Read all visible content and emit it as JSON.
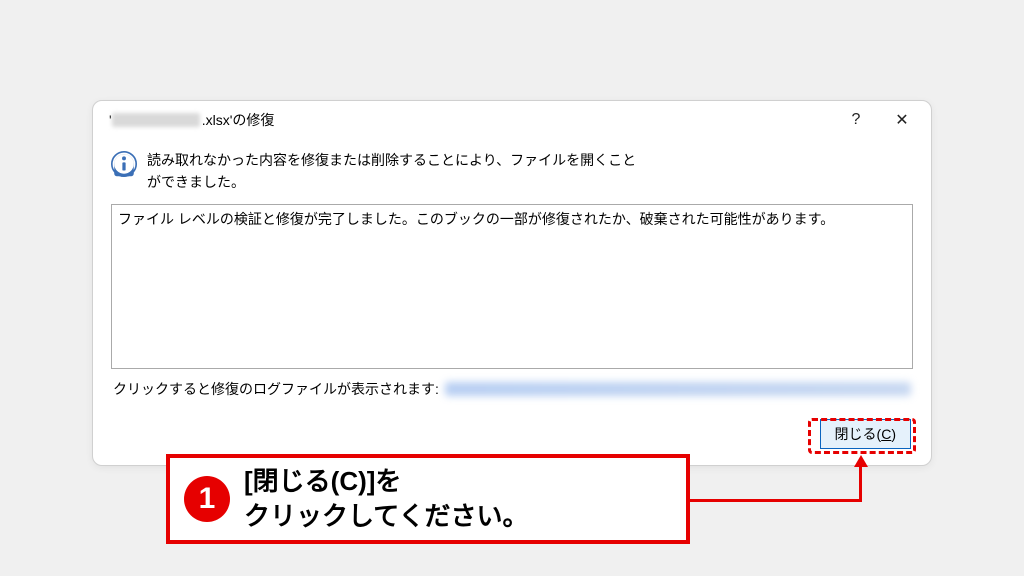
{
  "dialog": {
    "title_suffix": ".xlsx'の修復",
    "title_prefix": "'",
    "help_btn": "?",
    "close_x": "✕",
    "message_line1": "読み取れなかった内容を修復または削除することにより、ファイルを開くこと",
    "message_line2": "ができました。",
    "details": "ファイル レベルの検証と修復が完了しました。このブックの一部が修復されたか、破棄された可能性があります。",
    "log_label": "クリックすると修復のログファイルが表示されます: ",
    "close_btn_label": "閉じる(",
    "close_btn_key": "C",
    "close_btn_tail": ")"
  },
  "annotation": {
    "number": "1",
    "line1": "[閉じる(C)]を",
    "line2": "クリックしてください。"
  }
}
